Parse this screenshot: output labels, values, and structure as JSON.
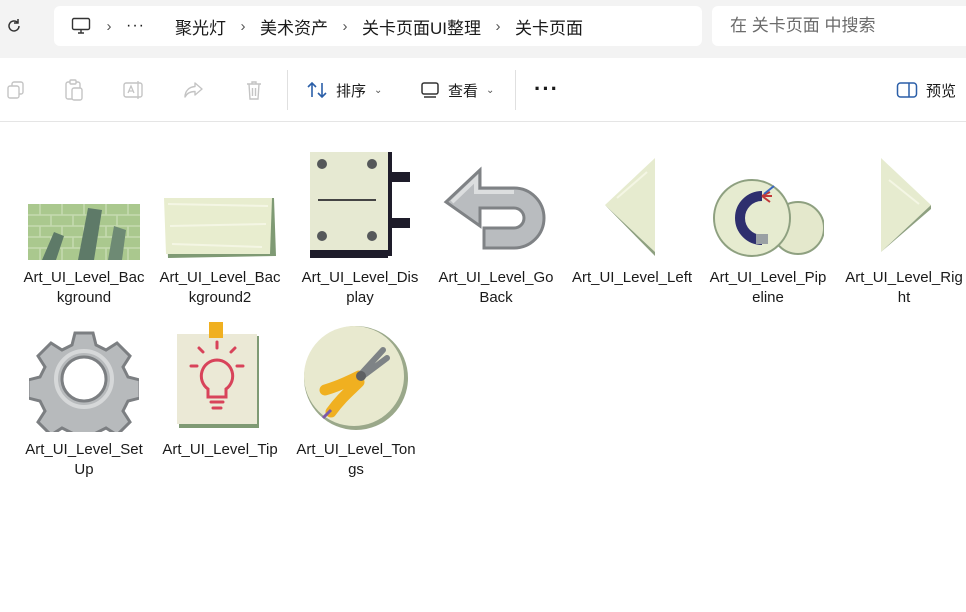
{
  "address_bar": {
    "path": [
      "聚光灯",
      "美术资产",
      "关卡页面UI整理",
      "关卡页面"
    ],
    "overflow_label": "···",
    "search_placeholder": "在 关卡页面 中搜索"
  },
  "toolbar": {
    "sort_label": "排序",
    "view_label": "查看",
    "more_label": "···",
    "preview_label": "预览"
  },
  "files": [
    {
      "name": "Art_UI_Level_Background",
      "icon": "brick-wall-image"
    },
    {
      "name": "Art_UI_Level_Background2",
      "icon": "paper-strip-image"
    },
    {
      "name": "Art_UI_Level_Display",
      "icon": "display-panel-image"
    },
    {
      "name": "Art_UI_Level_GoBack",
      "icon": "go-back-arrow-image"
    },
    {
      "name": "Art_UI_Level_Left",
      "icon": "left-triangle-image"
    },
    {
      "name": "Art_UI_Level_Pipeline",
      "icon": "pipeline-image"
    },
    {
      "name": "Art_UI_Level_Right",
      "icon": "right-triangle-image"
    },
    {
      "name": "Art_UI_Level_SetUp",
      "icon": "gear-image"
    },
    {
      "name": "Art_UI_Level_Tip",
      "icon": "lightbulb-image"
    },
    {
      "name": "Art_UI_Level_Tongs",
      "icon": "pliers-image"
    }
  ],
  "colors": {
    "address_bg": "#f3f3f3",
    "paper": "#e9ecd6",
    "paper_shadow": "#8a9a7a",
    "brick_green": "#a8c48a",
    "tip_red": "#d8435a",
    "pliers_yellow": "#f0b020"
  }
}
